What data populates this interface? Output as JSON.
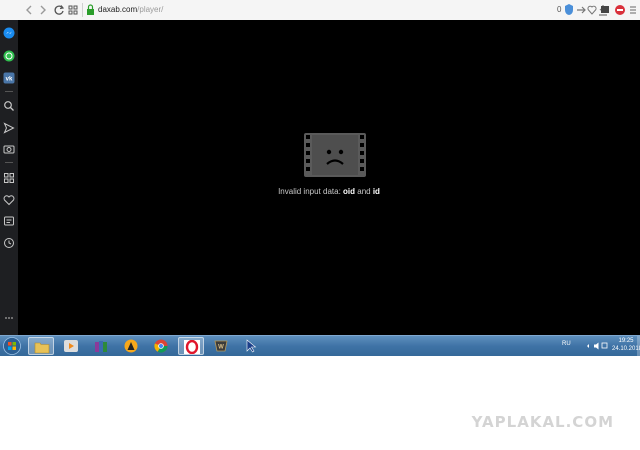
{
  "browser": {
    "url_domain": "daxab.com",
    "url_path": "/player/",
    "badge_count": "0"
  },
  "sidebar": {
    "items": [
      {
        "icon": "messenger-icon"
      },
      {
        "icon": "whatsapp-icon"
      },
      {
        "icon": "vk-icon"
      },
      {
        "icon": "search-icon"
      },
      {
        "icon": "send-icon"
      },
      {
        "icon": "camera-icon"
      },
      {
        "icon": "apps-grid-icon"
      },
      {
        "icon": "heart-icon"
      },
      {
        "icon": "notes-icon"
      },
      {
        "icon": "history-clock-icon"
      }
    ]
  },
  "player": {
    "error_prefix": "Invalid input data: ",
    "error_param1": "oid",
    "error_conj": " and ",
    "error_param2": "id"
  },
  "taskbar": {
    "language": "RU",
    "time": "19:25",
    "date": "24.10.2018"
  },
  "watermark": "YAPLAKAL.COM"
}
